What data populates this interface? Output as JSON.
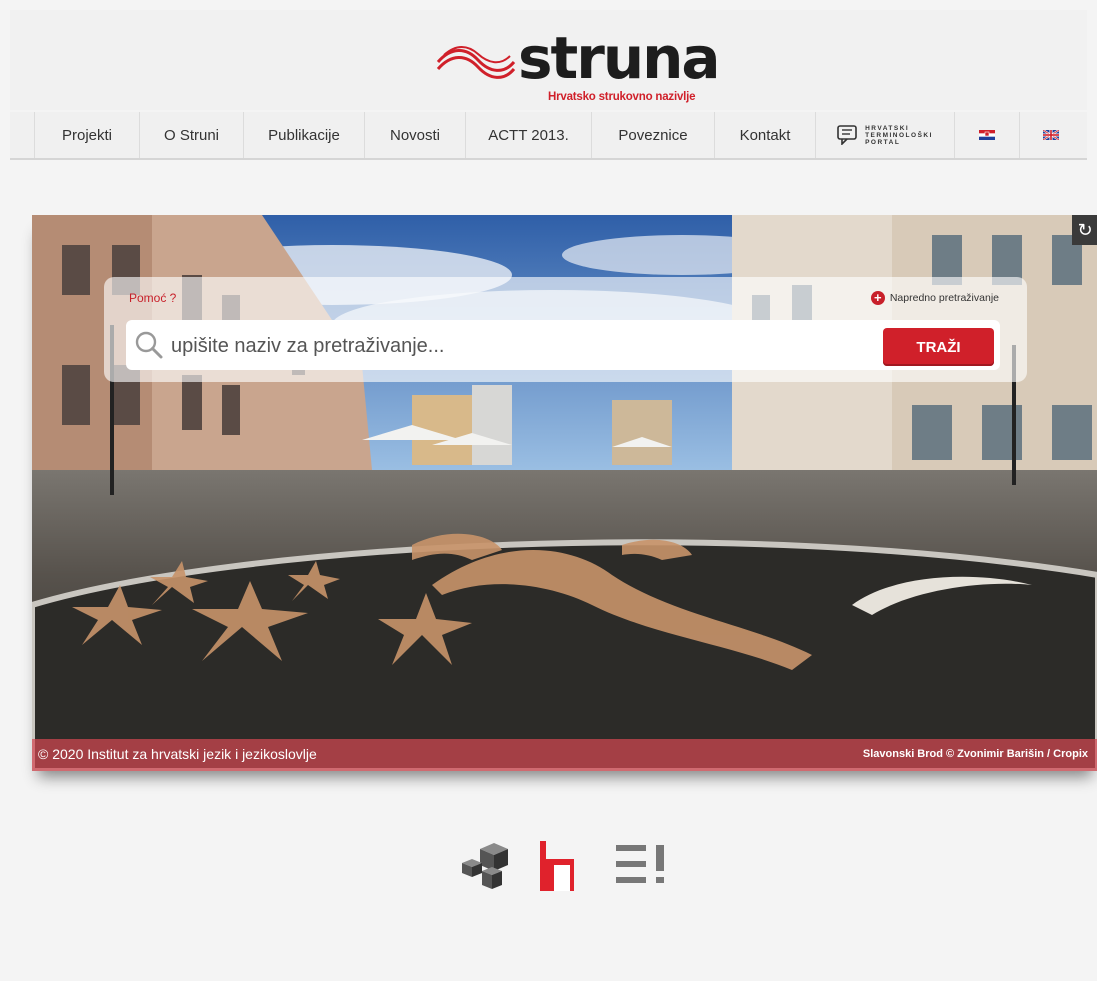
{
  "header": {
    "logo_word": "struna",
    "logo_tagline": "Hrvatsko strukovno nazivlje"
  },
  "nav": {
    "items": [
      {
        "label": "Projekti"
      },
      {
        "label": "O Struni"
      },
      {
        "label": "Publikacije"
      },
      {
        "label": "Novosti"
      },
      {
        "label": "ACTT 2013."
      },
      {
        "label": "Poveznice"
      },
      {
        "label": "Kontakt"
      }
    ],
    "portal_lines": [
      "HRVATSKI",
      "TERMINOLOŠKI",
      "PORTAL"
    ],
    "languages": [
      {
        "icon": "croatian-flag-icon"
      },
      {
        "icon": "uk-flag-icon"
      }
    ]
  },
  "search": {
    "help_label": "Pomoć ?",
    "advanced_label": "Napredno pretraživanje",
    "placeholder": "upišite naziv za pretraživanje...",
    "button_label": "TRAŽI"
  },
  "hero": {
    "copyright": "© 2020 Institut za hrvatski jezik i jezikoslovlje",
    "photo_credit": "Slavonski Brod © Zvonimir Barišin / Cropix",
    "refresh_icon": "refresh-icon"
  },
  "colors": {
    "accent": "#d0202a",
    "caption_bar": "#d2464f",
    "background": "#f4f4f4"
  }
}
